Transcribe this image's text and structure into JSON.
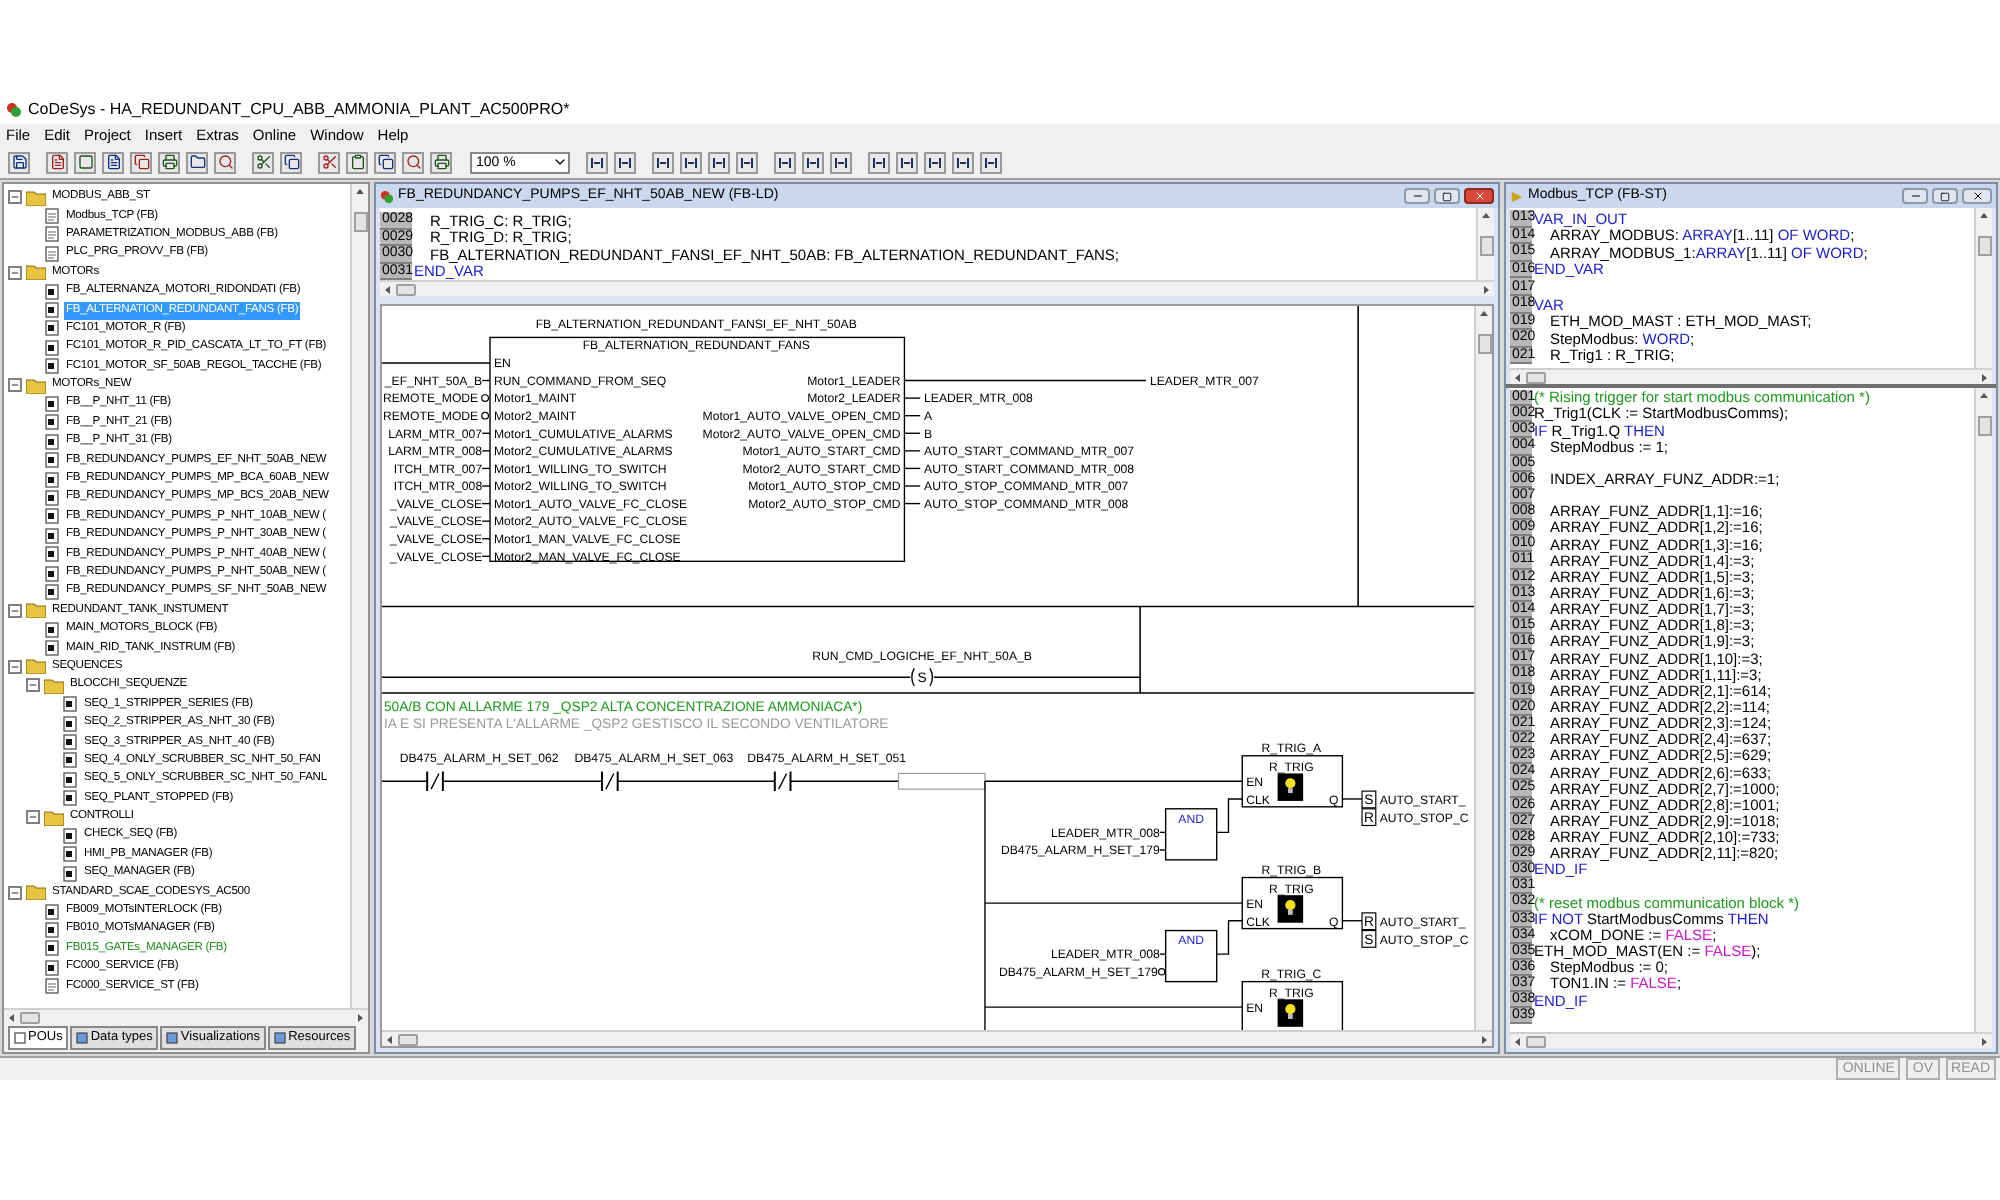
{
  "window": {
    "title": "CoDeSys - HA_REDUNDANT_CPU_ABB_AMMONIA_PLANT_AC500PRO*"
  },
  "menu": [
    "File",
    "Edit",
    "Project",
    "Insert",
    "Extras",
    "Online",
    "Window",
    "Help"
  ],
  "toolbar": {
    "zoom": "100 %"
  },
  "project_tree": {
    "items": [
      {
        "label": "MODBUS_ABB_ST",
        "kind": "folder",
        "expanded": true,
        "selected": false,
        "children": [
          {
            "label": "Modbus_TCP (FB)",
            "kind": "doc",
            "selected": false
          },
          {
            "label": "PARAMETRIZATION_MODBUS_ABB (FB)",
            "kind": "doc",
            "selected": false
          },
          {
            "label": "PLC_PRG_PROVV_FB (FB)",
            "kind": "doc",
            "selected": false
          }
        ]
      },
      {
        "label": "MOTORs",
        "kind": "folder",
        "expanded": true,
        "selected": false,
        "children": [
          {
            "label": "FB_ALTERNANZA_MOTORI_RIDONDATI (FB)",
            "kind": "block",
            "selected": false
          },
          {
            "label": "FB_ALTERNATION_REDUNDANT_FANS (FB)",
            "kind": "block",
            "selected": true
          },
          {
            "label": "FC101_MOTOR_R (FB)",
            "kind": "block",
            "selected": false
          },
          {
            "label": "FC101_MOTOR_R_PID_CASCATA_LT_TO_FT (FB)",
            "kind": "block",
            "selected": false
          },
          {
            "label": "FC101_MOTOR_SF_50AB_REGOL_TACCHE (FB)",
            "kind": "block",
            "selected": false
          }
        ]
      },
      {
        "label": "MOTORs_NEW",
        "kind": "folder",
        "expanded": true,
        "selected": false,
        "children": [
          {
            "label": "FB__P_NHT_11 (FB)",
            "kind": "block",
            "selected": false
          },
          {
            "label": "FB__P_NHT_21 (FB)",
            "kind": "block",
            "selected": false
          },
          {
            "label": "FB__P_NHT_31 (FB)",
            "kind": "block",
            "selected": false
          },
          {
            "label": "FB_REDUNDANCY_PUMPS_EF_NHT_50AB_NEW",
            "kind": "block",
            "selected": false
          },
          {
            "label": "FB_REDUNDANCY_PUMPS_MP_BCA_60AB_NEW",
            "kind": "block",
            "selected": false
          },
          {
            "label": "FB_REDUNDANCY_PUMPS_MP_BCS_20AB_NEW",
            "kind": "block",
            "selected": false
          },
          {
            "label": "FB_REDUNDANCY_PUMPS_P_NHT_10AB_NEW (",
            "kind": "block",
            "selected": false
          },
          {
            "label": "FB_REDUNDANCY_PUMPS_P_NHT_30AB_NEW (",
            "kind": "block",
            "selected": false
          },
          {
            "label": "FB_REDUNDANCY_PUMPS_P_NHT_40AB_NEW (",
            "kind": "block",
            "selected": false
          },
          {
            "label": "FB_REDUNDANCY_PUMPS_P_NHT_50AB_NEW (",
            "kind": "block",
            "selected": false
          },
          {
            "label": "FB_REDUNDANCY_PUMPS_SF_NHT_50AB_NEW",
            "kind": "block",
            "selected": false
          }
        ]
      },
      {
        "label": "REDUNDANT_TANK_INSTUMENT",
        "kind": "folder",
        "expanded": true,
        "selected": false,
        "children": [
          {
            "label": "MAIN_MOTORS_BLOCK (FB)",
            "kind": "block",
            "selected": false
          },
          {
            "label": "MAIN_RID_TANK_INSTRUM (FB)",
            "kind": "block",
            "selected": false
          }
        ]
      },
      {
        "label": "SEQUENCES",
        "kind": "folder",
        "expanded": true,
        "selected": false,
        "children": [
          {
            "label": "BLOCCHI_SEQUENZE",
            "kind": "folder",
            "expanded": true,
            "selected": false,
            "children": [
              {
                "label": "SEQ_1_STRIPPER_SERIES (FB)",
                "kind": "block",
                "selected": false
              },
              {
                "label": "SEQ_2_STRIPPER_AS_NHT_30 (FB)",
                "kind": "block",
                "selected": false
              },
              {
                "label": "SEQ_3_STRIPPER_AS_NHT_40 (FB)",
                "kind": "block",
                "selected": false
              },
              {
                "label": "SEQ_4_ONLY_SCRUBBER_SC_NHT_50_FAN",
                "kind": "block",
                "selected": false
              },
              {
                "label": "SEQ_5_ONLY_SCRUBBER_SC_NHT_50_FANL",
                "kind": "block",
                "selected": false
              },
              {
                "label": "SEQ_PLANT_STOPPED (FB)",
                "kind": "block",
                "selected": false
              }
            ]
          },
          {
            "label": "CONTROLLI",
            "kind": "folder",
            "expanded": true,
            "selected": false,
            "children": [
              {
                "label": "CHECK_SEQ (FB)",
                "kind": "block",
                "selected": false
              },
              {
                "label": "HMI_PB_MANAGER (FB)",
                "kind": "block",
                "selected": false
              },
              {
                "label": "SEQ_MANAGER (FB)",
                "kind": "block",
                "selected": false
              }
            ]
          }
        ]
      },
      {
        "label": "STANDARD_SCAE_CODESYS_AC500",
        "kind": "folder",
        "expanded": true,
        "selected": false,
        "children": [
          {
            "label": "FB009_MOTsINTERLOCK (FB)",
            "kind": "block",
            "selected": false
          },
          {
            "label": "FB010_MOTsMANAGER (FB)",
            "kind": "block",
            "selected": false
          },
          {
            "label": "FB015_GATEs_MANAGER (FB)",
            "kind": "block",
            "selected": false,
            "color": "#1f8f1f"
          },
          {
            "label": "FC000_SERVICE (FB)",
            "kind": "block",
            "selected": false
          },
          {
            "label": "FC000_SERVICE_ST (FB)",
            "kind": "doc",
            "selected": false
          }
        ]
      }
    ]
  },
  "tree_tabs": [
    {
      "label": "POUs",
      "selected": true
    },
    {
      "label": "Data types",
      "selected": false
    },
    {
      "label": "Visualizations",
      "selected": false
    },
    {
      "label": "Resources",
      "selected": false
    }
  ],
  "ld_window": {
    "title": "FB_REDUNDANCY_PUMPS_EF_NHT_50AB_NEW (FB-LD)",
    "declarations": [
      {
        "number": "0028",
        "indented": true,
        "tokens": [
          {
            "text": "R_TRIG_C: R_TRIG;",
            "kind": "plain"
          }
        ]
      },
      {
        "number": "0029",
        "indented": true,
        "tokens": [
          {
            "text": "R_TRIG_D: R_TRIG;",
            "kind": "plain"
          }
        ]
      },
      {
        "number": "0030",
        "indented": true,
        "tokens": [
          {
            "text": "FB_ALTERNATION_REDUNDANT_FANSI_EF_NHT_50AB: FB_ALTERNATION_REDUNDANT_FANS;",
            "kind": "plain"
          }
        ]
      },
      {
        "number": "0031",
        "indented": false,
        "tokens": [
          {
            "text": "END_VAR",
            "kind": "keyword"
          }
        ]
      }
    ],
    "network_1": {
      "instance": "FB_ALTERNATION_REDUNDANT_FANSI_EF_NHT_50AB",
      "type": "FB_ALTERNATION_REDUNDANT_FANS",
      "inputs": [
        {
          "pin": "EN",
          "negated": false
        },
        {
          "pin": "RUN_COMMAND_FROM_SEQ",
          "variable": "_EF_NHT_50A_B",
          "negated": false
        },
        {
          "pin": "Motor1_MAINT",
          "variable": "REMOTE_MODE",
          "negated": true
        },
        {
          "pin": "Motor2_MAINT",
          "variable": "REMOTE_MODE",
          "negated": true
        },
        {
          "pin": "Motor1_CUMULATIVE_ALARMS",
          "variable": "LARM_MTR_007",
          "negated": false
        },
        {
          "pin": "Motor2_CUMULATIVE_ALARMS",
          "variable": "LARM_MTR_008",
          "negated": false
        },
        {
          "pin": "Motor1_WILLING_TO_SWITCH",
          "variable": "ITCH_MTR_007",
          "negated": false
        },
        {
          "pin": "Motor2_WILLING_TO_SWITCH",
          "variable": "ITCH_MTR_008",
          "negated": false
        },
        {
          "pin": "Motor1_AUTO_VALVE_FC_CLOSE",
          "variable": "_VALVE_CLOSE",
          "negated": false
        },
        {
          "pin": "Motor2_AUTO_VALVE_FC_CLOSE",
          "variable": "_VALVE_CLOSE",
          "negated": false
        },
        {
          "pin": "Motor1_MAN_VALVE_FC_CLOSE",
          "variable": "_VALVE_CLOSE",
          "negated": false
        },
        {
          "pin": "Motor2_MAN_VALVE_FC_CLOSE",
          "variable": "_VALVE_CLOSE",
          "negated": false
        }
      ],
      "outputs": [
        {
          "pin": "Motor1_LEADER",
          "variable": "LEADER_MTR_007"
        },
        {
          "pin": "Motor2_LEADER",
          "variable": "LEADER_MTR_008"
        },
        {
          "pin": "Motor1_AUTO_VALVE_OPEN_CMD",
          "variable": "A"
        },
        {
          "pin": "Motor2_AUTO_VALVE_OPEN_CMD",
          "variable": "B"
        },
        {
          "pin": "Motor1_AUTO_START_CMD",
          "variable": "AUTO_START_COMMAND_MTR_007"
        },
        {
          "pin": "Motor2_AUTO_START_CMD",
          "variable": "AUTO_START_COMMAND_MTR_008"
        },
        {
          "pin": "Motor1_AUTO_STOP_CMD",
          "variable": "AUTO_STOP_COMMAND_MTR_007"
        },
        {
          "pin": "Motor2_AUTO_STOP_CMD",
          "variable": "AUTO_STOP_COMMAND_MTR_008"
        }
      ]
    },
    "network_2": {
      "coil": "S",
      "variable": "RUN_CMD_LOGICHE_EF_NHT_50A_B"
    },
    "network_3": {
      "comment_lines": [
        {
          "text": "50A/B CON ALLARME 179 _QSP2 ALTA CONCENTRAZIONE AMMONIACA*)",
          "color": "#1f9a1f"
        },
        {
          "text": "IA E SI PRESENTA L'ALLARME _QSP2 GESTISCO IL SECONDO VENTILATORE",
          "color": "#9a9a9a"
        }
      ],
      "contacts": [
        {
          "variable": "DB475_ALARM_H_SET_062",
          "negated": true
        },
        {
          "variable": "DB475_ALARM_H_SET_063",
          "negated": true
        },
        {
          "variable": "DB475_ALARM_H_SET_051",
          "negated": true
        }
      ],
      "triggers": [
        {
          "instance": "R_TRIG_A",
          "type": "R_TRIG",
          "en": "EN",
          "clk": "CLK",
          "q": "Q",
          "outputs": [
            {
              "coil": "S",
              "variable": "AUTO_START_"
            },
            {
              "coil": "R",
              "variable": "AUTO_STOP_C"
            }
          ],
          "gate": {
            "label": "AND",
            "inputs": [
              {
                "variable": "LEADER_MTR_008",
                "negated": false
              },
              {
                "variable": "DB475_ALARM_H_SET_179",
                "negated": false
              }
            ]
          }
        },
        {
          "instance": "R_TRIG_B",
          "type": "R_TRIG",
          "en": "EN",
          "clk": "CLK",
          "q": "Q",
          "outputs": [
            {
              "coil": "R",
              "variable": "AUTO_START_"
            },
            {
              "coil": "S",
              "variable": "AUTO_STOP_C"
            }
          ],
          "gate": {
            "label": "AND",
            "inputs": [
              {
                "variable": "LEADER_MTR_008",
                "negated": false
              },
              {
                "variable": "DB475_ALARM_H_SET_179",
                "negated": true
              }
            ]
          }
        },
        {
          "instance": "R_TRIG_C",
          "type": "R_TRIG",
          "en": "EN"
        }
      ]
    }
  },
  "st_window": {
    "title": "Modbus_TCP (FB-ST)",
    "declarations": [
      {
        "number": "013",
        "indented": false,
        "tokens": [
          {
            "text": "VAR_IN_OUT",
            "kind": "keyword"
          }
        ]
      },
      {
        "number": "014",
        "indented": true,
        "tokens": [
          {
            "text": "ARRAY_MODBUS: ",
            "kind": "plain"
          },
          {
            "text": "ARRAY",
            "kind": "keyword"
          },
          {
            "text": "[1..11] ",
            "kind": "plain"
          },
          {
            "text": "OF WORD",
            "kind": "keyword"
          },
          {
            "text": ";",
            "kind": "plain"
          }
        ]
      },
      {
        "number": "015",
        "indented": true,
        "tokens": [
          {
            "text": "ARRAY_MODBUS_1:",
            "kind": "plain"
          },
          {
            "text": "ARRAY",
            "kind": "keyword"
          },
          {
            "text": "[1..11] ",
            "kind": "plain"
          },
          {
            "text": "OF WORD",
            "kind": "keyword"
          },
          {
            "text": ";",
            "kind": "plain"
          }
        ]
      },
      {
        "number": "016",
        "indented": false,
        "tokens": [
          {
            "text": "END_VAR",
            "kind": "keyword"
          }
        ]
      },
      {
        "number": "017"
      },
      {
        "number": "018",
        "indented": false,
        "tokens": [
          {
            "text": "VAR",
            "kind": "keyword"
          }
        ]
      },
      {
        "number": "019",
        "indented": true,
        "tokens": [
          {
            "text": "ETH_MOD_MAST : ETH_MOD_MAST;",
            "kind": "plain"
          }
        ]
      },
      {
        "number": "020",
        "indented": true,
        "tokens": [
          {
            "text": "StepModbus: ",
            "kind": "plain"
          },
          {
            "text": "WORD",
            "kind": "keyword"
          },
          {
            "text": ";",
            "kind": "plain"
          }
        ]
      },
      {
        "number": "021",
        "indented": true,
        "tokens": [
          {
            "text": "R_Trig1 : R_TRIG;",
            "kind": "plain"
          }
        ]
      }
    ],
    "body": [
      {
        "number": "001",
        "indented": false,
        "tokens": [
          {
            "text": "(* Rising trigger for start modbus communication *)",
            "kind": "comment"
          }
        ]
      },
      {
        "number": "002",
        "indented": false,
        "tokens": [
          {
            "text": "R_Trig1(CLK := StartModbusComms);",
            "kind": "plain"
          }
        ]
      },
      {
        "number": "003",
        "indented": false,
        "tokens": [
          {
            "text": "IF",
            "kind": "keyword"
          },
          {
            "text": " R_Trig1.Q ",
            "kind": "plain"
          },
          {
            "text": "THEN",
            "kind": "keyword"
          }
        ]
      },
      {
        "number": "004",
        "indented": true,
        "tokens": [
          {
            "text": "StepModbus := 1;",
            "kind": "plain"
          }
        ]
      },
      {
        "number": "005"
      },
      {
        "number": "006",
        "indented": true,
        "tokens": [
          {
            "text": "INDEX_ARRAY_FUNZ_ADDR:=1;",
            "kind": "plain"
          }
        ]
      },
      {
        "number": "007"
      },
      {
        "number": "008",
        "indented": true,
        "tokens": [
          {
            "text": "ARRAY_FUNZ_ADDR[1,1]:=16;",
            "kind": "plain"
          }
        ]
      },
      {
        "number": "009",
        "indented": true,
        "tokens": [
          {
            "text": "ARRAY_FUNZ_ADDR[1,2]:=16;",
            "kind": "plain"
          }
        ]
      },
      {
        "number": "010",
        "indented": true,
        "tokens": [
          {
            "text": "ARRAY_FUNZ_ADDR[1,3]:=16;",
            "kind": "plain"
          }
        ]
      },
      {
        "number": "011",
        "indented": true,
        "tokens": [
          {
            "text": "ARRAY_FUNZ_ADDR[1,4]:=3;",
            "kind": "plain"
          }
        ]
      },
      {
        "number": "012",
        "indented": true,
        "tokens": [
          {
            "text": "ARRAY_FUNZ_ADDR[1,5]:=3;",
            "kind": "plain"
          }
        ]
      },
      {
        "number": "013",
        "indented": true,
        "tokens": [
          {
            "text": "ARRAY_FUNZ_ADDR[1,6]:=3;",
            "kind": "plain"
          }
        ]
      },
      {
        "number": "014",
        "indented": true,
        "tokens": [
          {
            "text": "ARRAY_FUNZ_ADDR[1,7]:=3;",
            "kind": "plain"
          }
        ]
      },
      {
        "number": "015",
        "indented": true,
        "tokens": [
          {
            "text": "ARRAY_FUNZ_ADDR[1,8]:=3;",
            "kind": "plain"
          }
        ]
      },
      {
        "number": "016",
        "indented": true,
        "tokens": [
          {
            "text": "ARRAY_FUNZ_ADDR[1,9]:=3;",
            "kind": "plain"
          }
        ]
      },
      {
        "number": "017",
        "indented": true,
        "tokens": [
          {
            "text": "ARRAY_FUNZ_ADDR[1,10]:=3;",
            "kind": "plain"
          }
        ]
      },
      {
        "number": "018",
        "indented": true,
        "tokens": [
          {
            "text": "ARRAY_FUNZ_ADDR[1,11]:=3;",
            "kind": "plain"
          }
        ]
      },
      {
        "number": "019",
        "indented": true,
        "tokens": [
          {
            "text": "ARRAY_FUNZ_ADDR[2,1]:=614;",
            "kind": "plain"
          }
        ]
      },
      {
        "number": "020",
        "indented": true,
        "tokens": [
          {
            "text": "ARRAY_FUNZ_ADDR[2,2]:=114;",
            "kind": "plain"
          }
        ]
      },
      {
        "number": "021",
        "indented": true,
        "tokens": [
          {
            "text": "ARRAY_FUNZ_ADDR[2,3]:=124;",
            "kind": "plain"
          }
        ]
      },
      {
        "number": "022",
        "indented": true,
        "tokens": [
          {
            "text": "ARRAY_FUNZ_ADDR[2,4]:=637;",
            "kind": "plain"
          }
        ]
      },
      {
        "number": "023",
        "indented": true,
        "tokens": [
          {
            "text": "ARRAY_FUNZ_ADDR[2,5]:=629;",
            "kind": "plain"
          }
        ]
      },
      {
        "number": "024",
        "indented": true,
        "tokens": [
          {
            "text": "ARRAY_FUNZ_ADDR[2,6]:=633;",
            "kind": "plain"
          }
        ]
      },
      {
        "number": "025",
        "indented": true,
        "tokens": [
          {
            "text": "ARRAY_FUNZ_ADDR[2,7]:=1000;",
            "kind": "plain"
          }
        ]
      },
      {
        "number": "026",
        "indented": true,
        "tokens": [
          {
            "text": "ARRAY_FUNZ_ADDR[2,8]:=1001;",
            "kind": "plain"
          }
        ]
      },
      {
        "number": "027",
        "indented": true,
        "tokens": [
          {
            "text": "ARRAY_FUNZ_ADDR[2,9]:=1018;",
            "kind": "plain"
          }
        ]
      },
      {
        "number": "028",
        "indented": true,
        "tokens": [
          {
            "text": "ARRAY_FUNZ_ADDR[2,10]:=733;",
            "kind": "plain"
          }
        ]
      },
      {
        "number": "029",
        "indented": true,
        "tokens": [
          {
            "text": "ARRAY_FUNZ_ADDR[2,11]:=820;",
            "kind": "plain"
          }
        ]
      },
      {
        "number": "030",
        "indented": false,
        "tokens": [
          {
            "text": "END_IF",
            "kind": "keyword"
          }
        ]
      },
      {
        "number": "031"
      },
      {
        "number": "032",
        "indented": false,
        "tokens": [
          {
            "text": "(* reset modbus communication block *)",
            "kind": "comment"
          }
        ]
      },
      {
        "number": "033",
        "indented": false,
        "tokens": [
          {
            "text": "IF NOT",
            "kind": "keyword"
          },
          {
            "text": " StartModbusComms ",
            "kind": "plain"
          },
          {
            "text": "THEN",
            "kind": "keyword"
          }
        ]
      },
      {
        "number": "034",
        "indented": true,
        "tokens": [
          {
            "text": "xCOM_DONE := ",
            "kind": "plain"
          },
          {
            "text": "FALSE",
            "kind": "literal"
          },
          {
            "text": ";",
            "kind": "plain"
          }
        ]
      },
      {
        "number": "035",
        "indented": false,
        "tokens": [
          {
            "text": "ETH_MOD_MAST(EN := ",
            "kind": "plain"
          },
          {
            "text": "FALSE",
            "kind": "literal"
          },
          {
            "text": ");",
            "kind": "plain"
          }
        ]
      },
      {
        "number": "036",
        "indented": true,
        "tokens": [
          {
            "text": "StepModbus := 0;",
            "kind": "plain"
          }
        ]
      },
      {
        "number": "037",
        "indented": true,
        "tokens": [
          {
            "text": "TON1.IN := ",
            "kind": "plain"
          },
          {
            "text": "FALSE",
            "kind": "literal"
          },
          {
            "text": ";",
            "kind": "plain"
          }
        ]
      },
      {
        "number": "038",
        "indented": false,
        "tokens": [
          {
            "text": "END_IF",
            "kind": "keyword"
          }
        ]
      },
      {
        "number": "039"
      }
    ]
  },
  "status_bar": [
    "ONLINE",
    "OV",
    "READ"
  ]
}
